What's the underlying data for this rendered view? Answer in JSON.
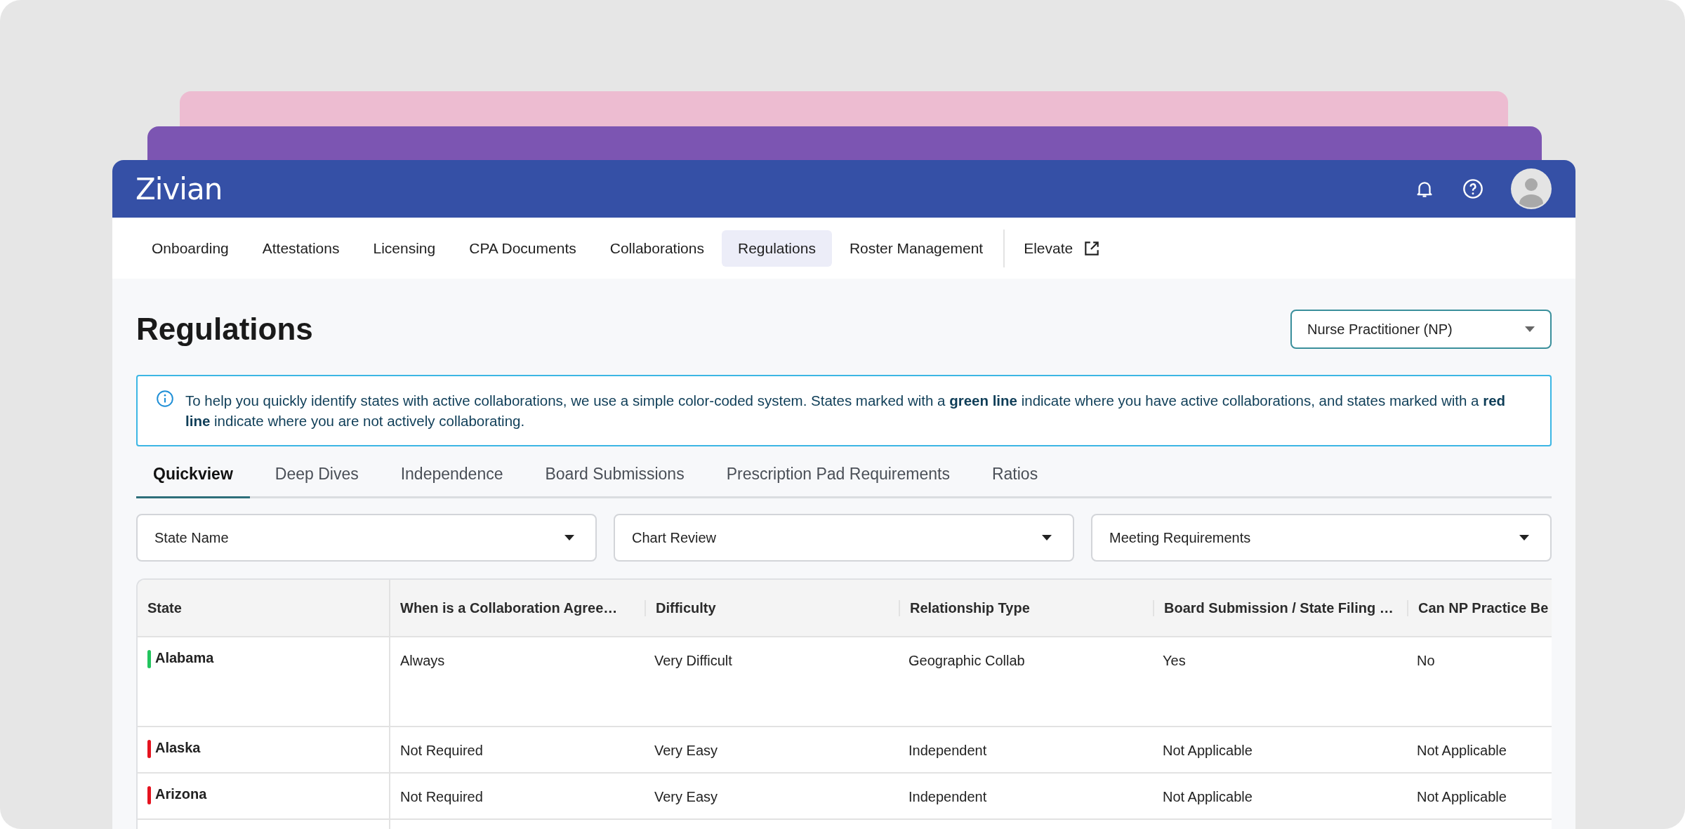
{
  "header": {
    "logo": "Zivian"
  },
  "nav": [
    {
      "label": "Onboarding",
      "selected": false,
      "external": false
    },
    {
      "label": "Attestations",
      "selected": false,
      "external": false
    },
    {
      "label": "Licensing",
      "selected": false,
      "external": false
    },
    {
      "label": "CPA Documents",
      "selected": false,
      "external": false
    },
    {
      "label": "Collaborations",
      "selected": false,
      "external": false
    },
    {
      "label": "Regulations",
      "selected": true,
      "external": false
    },
    {
      "label": "Roster Management",
      "selected": false,
      "external": false
    },
    {
      "label": "Elevate",
      "selected": false,
      "external": true
    }
  ],
  "page_title": "Regulations",
  "role_select": {
    "value": "Nurse Practitioner (NP)"
  },
  "info": "To help you quickly identify states with active collaborations, we use a simple color-coded system. States marked with a **green line** indicate where you have active collaborations, and states marked with a **red line** indicate where you are not actively collaborating.",
  "tabs": [
    {
      "label": "Quickview",
      "selected": true
    },
    {
      "label": "Deep Dives",
      "selected": false
    },
    {
      "label": "Independence",
      "selected": false
    },
    {
      "label": "Board Submissions",
      "selected": false
    },
    {
      "label": "Prescription Pad Requirements",
      "selected": false
    },
    {
      "label": "Ratios",
      "selected": false
    }
  ],
  "filters": [
    {
      "placeholder": "State Name"
    },
    {
      "placeholder": "Chart Review"
    },
    {
      "placeholder": "Meeting Requirements"
    }
  ],
  "table": {
    "columns": [
      "State",
      "When is a Collaboration Agree…",
      "Difficulty",
      "Relationship Type",
      "Board Submission / State Filing …",
      "Can NP Practice Be"
    ],
    "rows": [
      {
        "color": "#22c55e",
        "cells": [
          "Alabama",
          "Always",
          "Very Difficult",
          "Geographic Collab",
          "Yes",
          "No"
        ]
      },
      {
        "color": "#e5131f",
        "cells": [
          "Alaska",
          "Not Required",
          "Very Easy",
          "Independent",
          "Not Applicable",
          "Not Applicable"
        ]
      },
      {
        "color": "#e5131f",
        "cells": [
          "Arizona",
          "Not Required",
          "Very Easy",
          "Independent",
          "Not Applicable",
          "Not Applicable"
        ]
      }
    ]
  }
}
